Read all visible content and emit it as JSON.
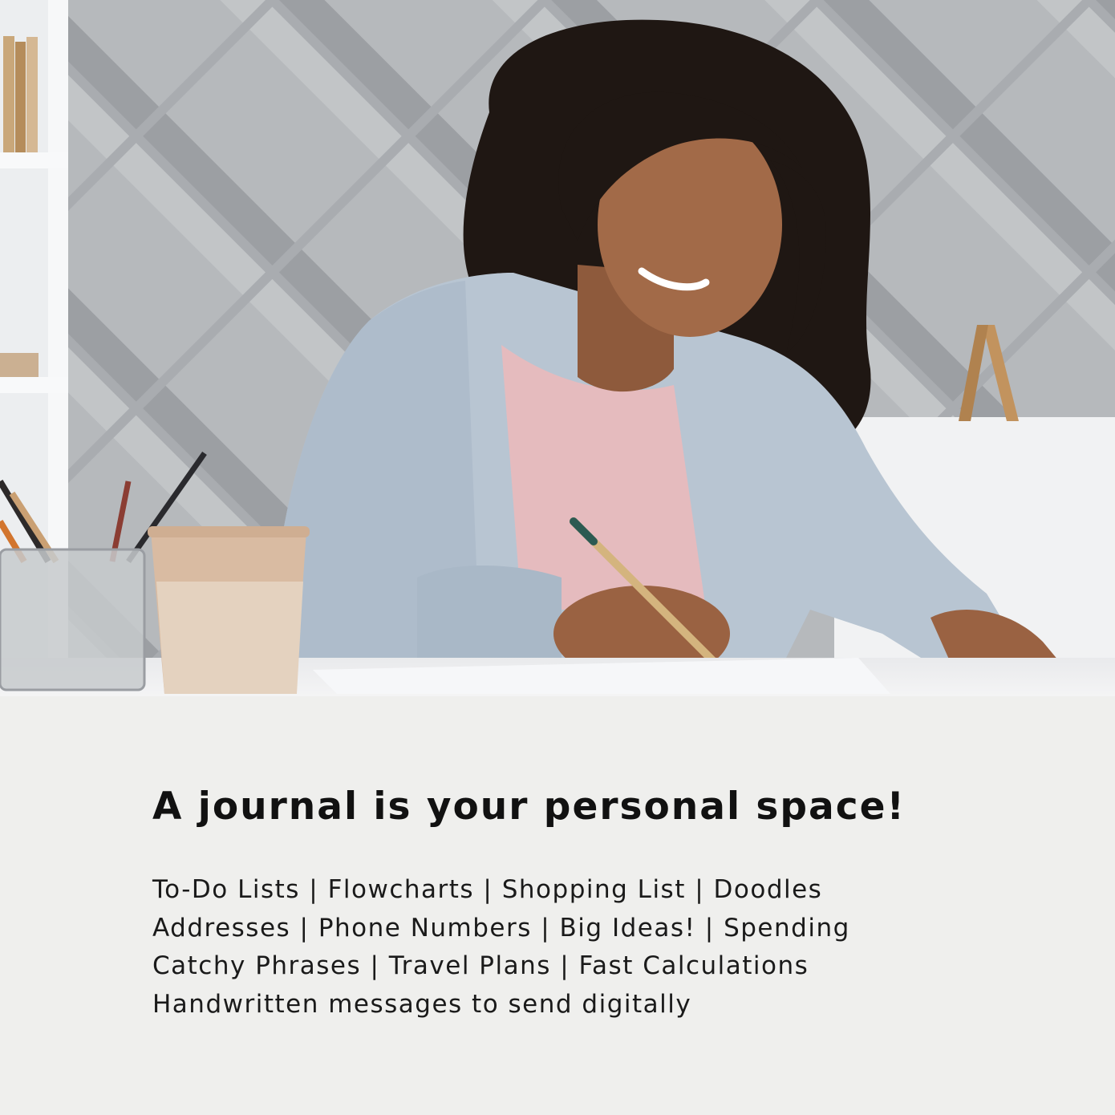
{
  "headline": "A journal is your personal space!",
  "uses": [
    "To-Do Lists | Flowcharts | Shopping List | Doodles",
    "Addresses | Phone Numbers | Big Ideas! | Spending",
    "Catchy Phrases | Travel Plans | Fast Calculations",
    "Handwritten messages to send digitally"
  ],
  "colors": {
    "panel_background": "#efefed",
    "text": "#111111",
    "wall": "#a9acb0",
    "cardigan": "#b8c6d3",
    "shirt": "#e6bcbf",
    "hair": "#1e1612",
    "skin": "#9a6444",
    "cup": "#d6b79c"
  }
}
